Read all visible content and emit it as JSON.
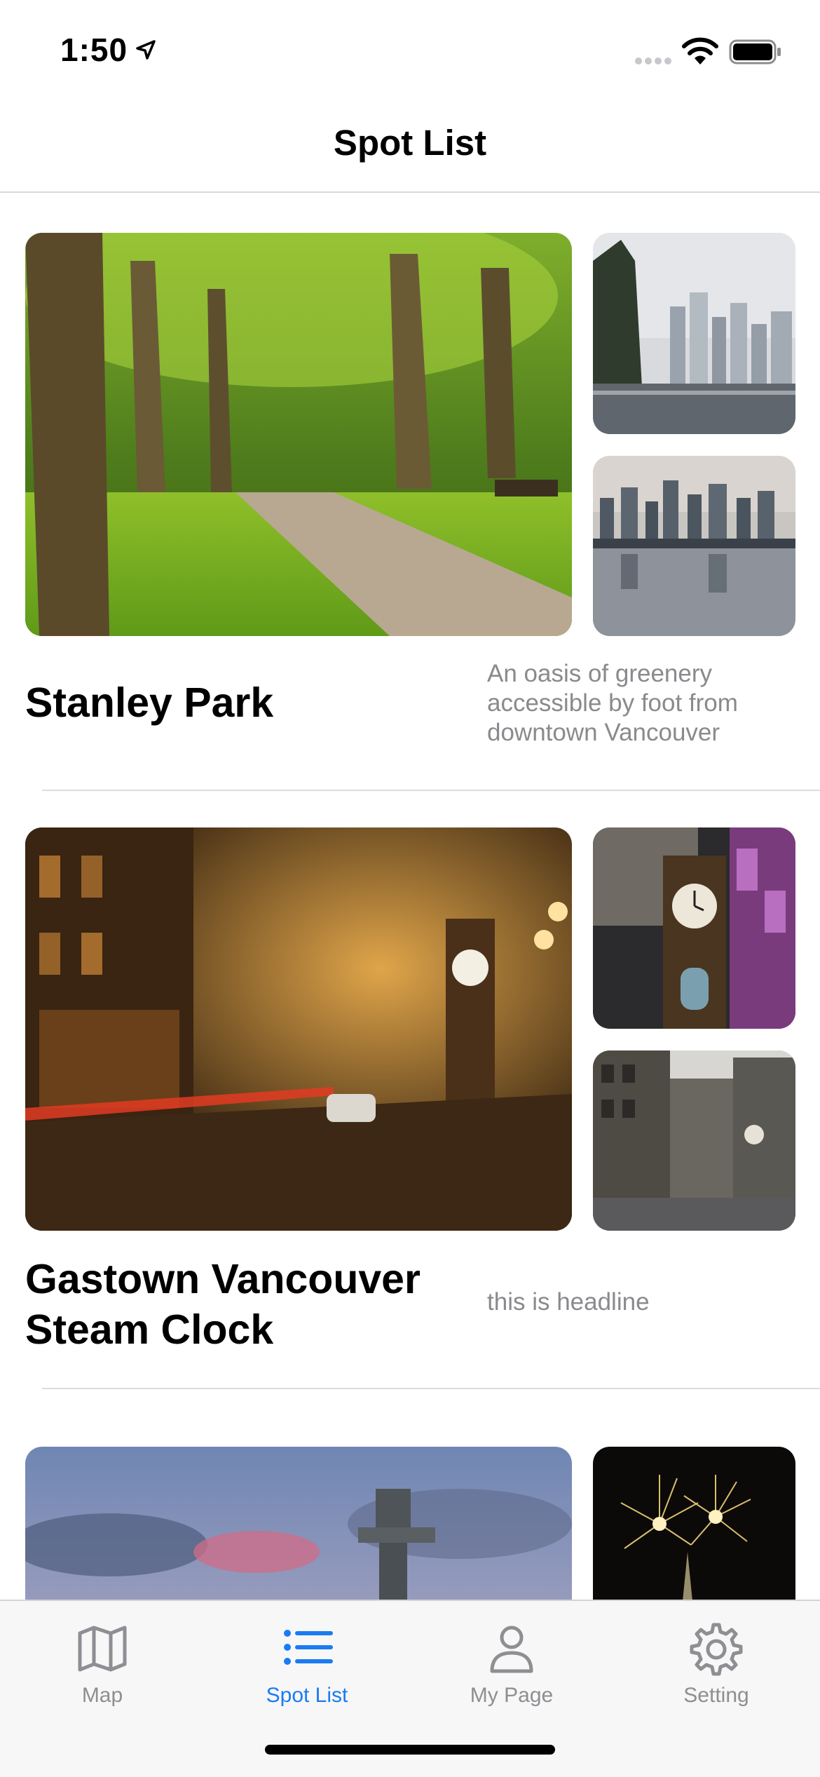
{
  "status": {
    "time": "1:50"
  },
  "nav": {
    "title": "Spot List"
  },
  "spots": [
    {
      "title": "Stanley Park",
      "description": "An oasis of greenery accessible by foot from downtown Vancouver"
    },
    {
      "title": "Gastown Vancouver Steam Clock",
      "description": "this is headline"
    }
  ],
  "tabs": [
    {
      "label": "Map",
      "icon": "map-icon"
    },
    {
      "label": "Spot List",
      "icon": "list-icon",
      "active": true
    },
    {
      "label": "My Page",
      "icon": "person-icon"
    },
    {
      "label": "Setting",
      "icon": "gear-icon"
    }
  ],
  "colors": {
    "accent": "#1a7cf2",
    "inactive": "#8e8e93"
  }
}
